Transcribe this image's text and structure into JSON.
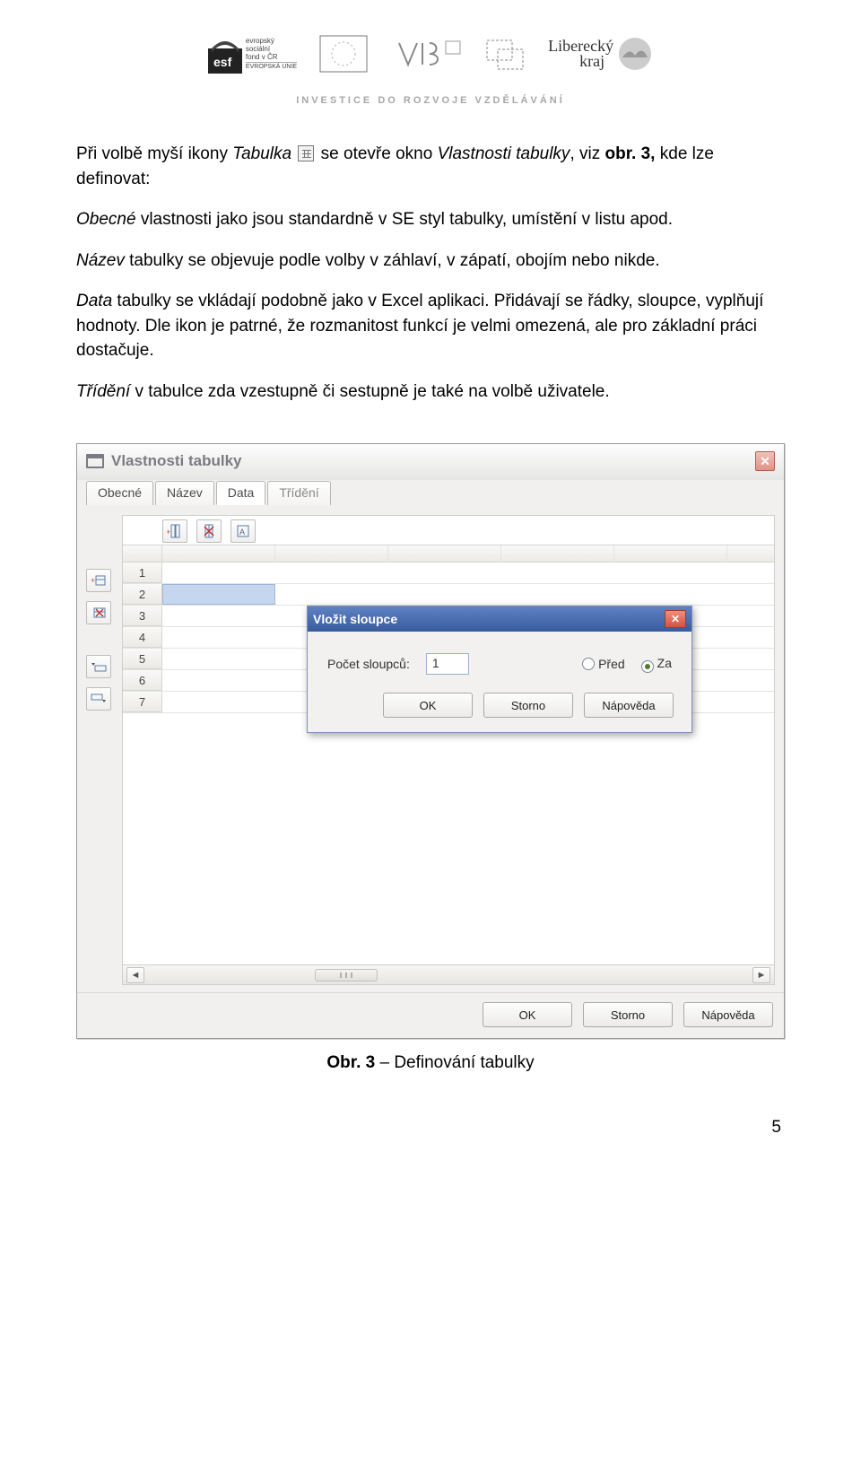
{
  "header": {
    "logos": {
      "esf_text1": "evropský",
      "esf_text2": "sociální",
      "esf_text3": "fond v ČR",
      "eu_text": "EVROPSKÁ UNIE",
      "kraj": "Liberecký",
      "kraj2": "kraj"
    },
    "investice": "INVESTICE DO ROZVOJE VZDĚLÁVÁNÍ"
  },
  "para1_a": "Při volbě myší ikony ",
  "para1_b": "Tabulka",
  "para1_c": " se otevře okno ",
  "para1_d": "Vlastnosti tabulky",
  "para1_e": ", viz ",
  "para1_f": "obr. 3,",
  "para1_g": " kde lze definovat:",
  "para2_a": "Obecné",
  "para2_b": " vlastnosti jako jsou standardně v SE styl tabulky, umístění v listu apod.",
  "para3_a": "Název",
  "para3_b": " tabulky se objevuje podle volby v záhlaví, v zápatí, obojím nebo nikde.",
  "para4_a": "Data",
  "para4_b": " tabulky se vkládají podobně jako v Excel aplikaci. Přidávají se řádky, sloupce, vyplňují hodnoty. Dle ikon je patrné, že rozmanitost funkcí je velmi omezená, ale pro základní práci dostačuje.",
  "para5_a": "Třídění",
  "para5_b": " v tabulce zda vzestupně či sestupně je také na volbě uživatele.",
  "dialog": {
    "title": "Vlastnosti tabulky",
    "tabs": [
      "Obecné",
      "Název",
      "Data",
      "Třídění"
    ],
    "row_numbers": [
      "1",
      "2",
      "3",
      "4",
      "5",
      "6",
      "7"
    ],
    "inner": {
      "title": "Vložit sloupce",
      "count_label": "Počet sloupců:",
      "count_value": "1",
      "option_before": "Před",
      "option_after": "Za"
    },
    "buttons": {
      "ok": "OK",
      "cancel": "Storno",
      "help": "Nápověda"
    }
  },
  "caption_a": "Obr. 3",
  "caption_b": " – Definování tabulky",
  "pagenum": "5"
}
